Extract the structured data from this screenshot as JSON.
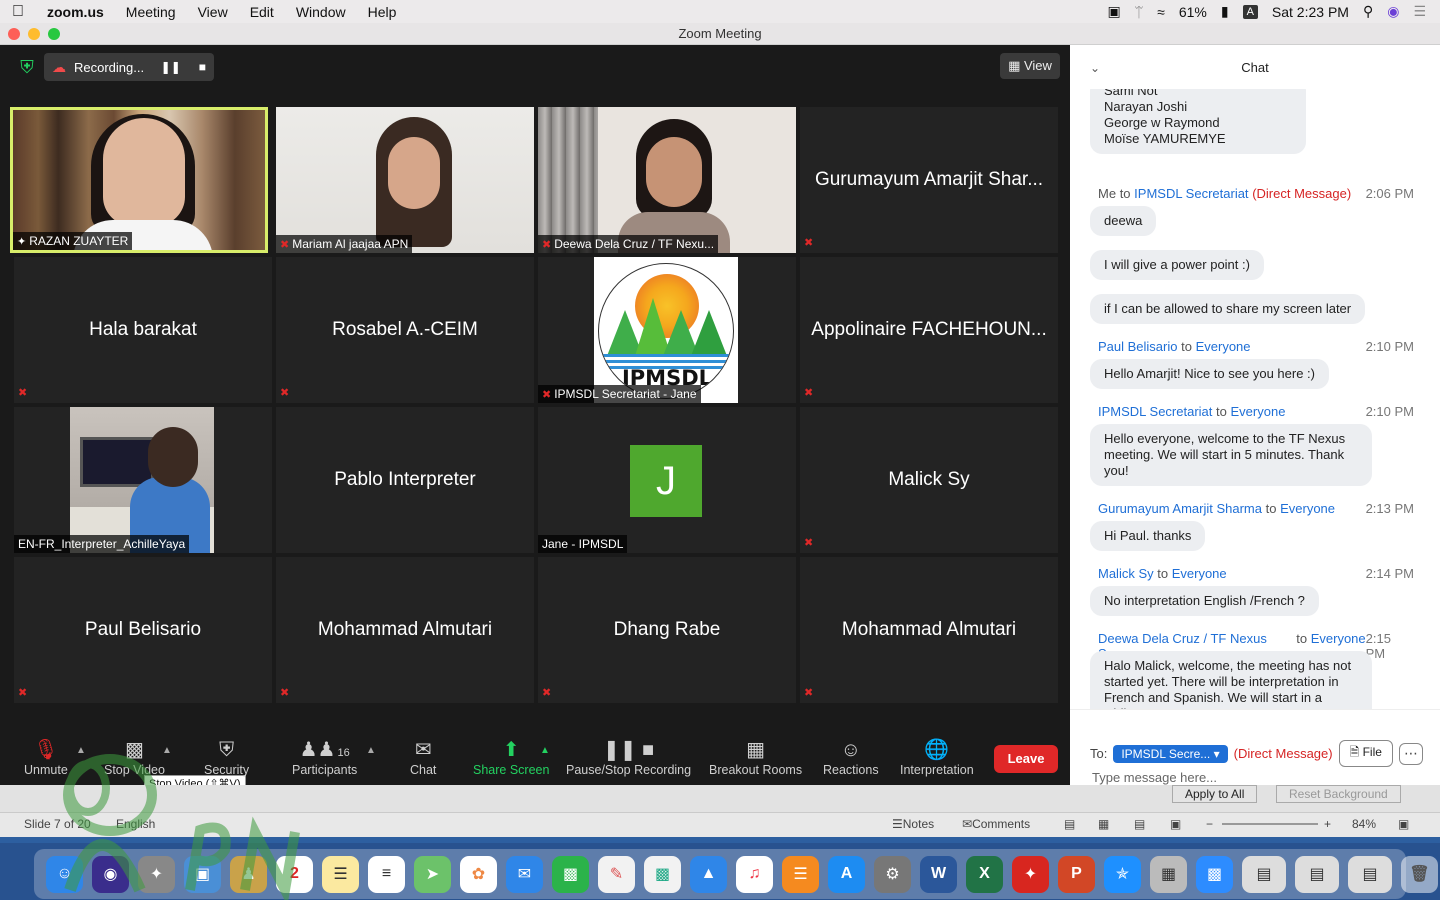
{
  "menubar": {
    "app": "zoom.us",
    "items": [
      "Meeting",
      "View",
      "Edit",
      "Window",
      "Help"
    ],
    "battery": "61%",
    "input_source": "A",
    "clock": "Sat 2:23 PM"
  },
  "window": {
    "title": "Zoom Meeting"
  },
  "top": {
    "recording": "Recording...",
    "view_label": "View"
  },
  "tiles": [
    {
      "name": "RAZAN ZUAYTER"
    },
    {
      "name": "Mariam Al jaajaa APN"
    },
    {
      "name": "Deewa Dela Cruz / TF Nexu..."
    },
    {
      "name": "Gurumayum Amarjit Shar..."
    },
    {
      "name": "Hala barakat"
    },
    {
      "name": "Rosabel A.-CEIM"
    },
    {
      "name": "IPMSDL Secretariat - Jane",
      "logo": "IPMSDL"
    },
    {
      "name": "Appolinaire FACHEHOUN..."
    },
    {
      "name": "EN-FR_Interpreter_AchilleYaya"
    },
    {
      "name": "Pablo Interpreter"
    },
    {
      "name": "Jane - IPMSDL",
      "initial": "J"
    },
    {
      "name": "Malick Sy"
    },
    {
      "name": "Paul Belisario"
    },
    {
      "name": "Mohammad Almutari"
    },
    {
      "name": "Dhang Rabe"
    },
    {
      "name": "Mohammad Almutari"
    }
  ],
  "toolbar": {
    "unmute": "Unmute",
    "stop_video": "Stop Video",
    "security": "Security",
    "participants": "Participants",
    "participant_count": "16",
    "chat": "Chat",
    "share_screen": "Share Screen",
    "pause_stop_recording": "Pause/Stop Recording",
    "breakout_rooms": "Breakout Rooms",
    "reactions": "Reactions",
    "interpretation": "Interpretation",
    "leave": "Leave",
    "tooltip": "Stop Video (⇧⌘V)"
  },
  "chat": {
    "title": "Chat",
    "earlier_names": [
      "Sami Not",
      "Narayan Joshi",
      "George w Raymond",
      "Moïse YAMUREMYE"
    ],
    "messages": [
      {
        "from": "Me",
        "to": "IPMSDL Secretariat",
        "direct": "(Direct Message)",
        "time": "2:06 PM",
        "lines": [
          "deewa",
          "I will give a power point :)",
          "if I can be allowed to share my screen later"
        ]
      },
      {
        "from": "Paul Belisario",
        "to": "Everyone",
        "time": "2:10 PM",
        "lines": [
          "Hello Amarjit! Nice to see you here :)"
        ]
      },
      {
        "from": "IPMSDL Secretariat",
        "to": "Everyone",
        "time": "2:10 PM",
        "lines": [
          "Hello everyone, welcome to the TF Nexus meeting. We will start in 5 minutes. Thank you!"
        ]
      },
      {
        "from": "Gurumayum Amarjit Sharma",
        "to": "Everyone",
        "time": "2:13 PM",
        "lines": [
          "Hi Paul. thanks"
        ]
      },
      {
        "from": "Malick Sy",
        "to": "Everyone",
        "time": "2:14 PM",
        "lines": [
          "No interpretation English /French ?"
        ]
      },
      {
        "from": "Deewa Dela Cruz / TF Nexus Sec",
        "to": "Everyone",
        "time": "2:15 PM",
        "lines": [
          "Halo Malick, welcome, the meeting has not started yet. There will be interpretation in French and Spanish.  We will start in a while."
        ]
      }
    ],
    "to_label": "To:",
    "to_target": "IPMSDL Secre...",
    "to_direct": "(Direct Message)",
    "file_label": "File",
    "placeholder": "Type message here...",
    "to_word": "to"
  },
  "powerpoint": {
    "apply_to_all": "Apply to All",
    "reset_background": "Reset Background",
    "slide": "Slide 7 of 20",
    "language": "English",
    "notes": "Notes",
    "comments": "Comments",
    "zoom": "84%"
  },
  "watermark": "APN"
}
